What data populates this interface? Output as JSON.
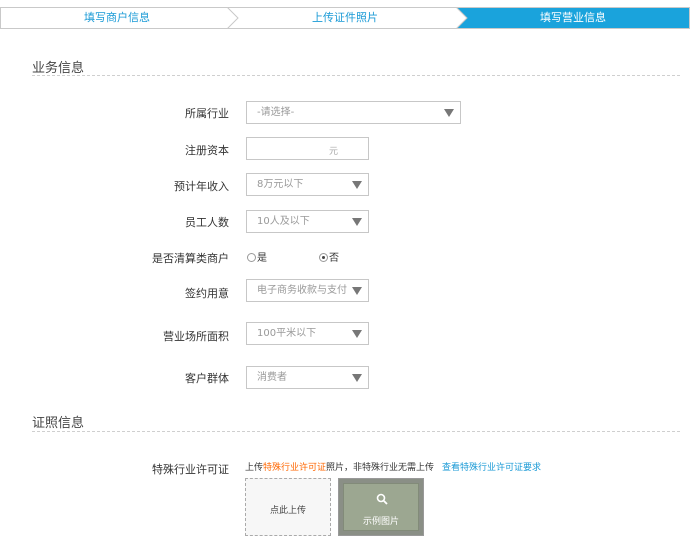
{
  "steps": [
    {
      "label": "填写商户信息"
    },
    {
      "label": "上传证件照片"
    },
    {
      "label": "填写营业信息"
    }
  ],
  "business": {
    "section_title": "业务信息",
    "industry": {
      "label": "所属行业",
      "value": "-请选择-"
    },
    "capital": {
      "label": "注册资本",
      "value": "",
      "unit": "元"
    },
    "income": {
      "label": "预计年收入",
      "value": "8万元以下"
    },
    "staff": {
      "label": "员工人数",
      "value": "10人及以下"
    },
    "clearing": {
      "label": "是否清算类商户",
      "options": [
        "是",
        "否"
      ],
      "selected": "否"
    },
    "intent": {
      "label": "签约用意",
      "value": "电子商务收款与支付"
    },
    "area": {
      "label": "营业场所面积",
      "value": "100平米以下"
    },
    "customers": {
      "label": "客户群体",
      "value": "消费者"
    }
  },
  "license": {
    "section_title": "证照信息",
    "special": {
      "label": "特殊行业许可证",
      "note_prefix": "上传",
      "note_highlight": "特殊行业许可证",
      "note_suffix": "照片，非特殊行业无需上传",
      "note_link": "查看特殊行业许可证要求",
      "upload_label": "点此上传",
      "sample_label": "示例图片"
    }
  },
  "colors": {
    "accent": "#1aa3dc",
    "highlight": "#ff6600",
    "link": "#1a9ad6"
  },
  "icons": {
    "sample": "magnifier-icon",
    "select": "triangle-down-icon"
  }
}
